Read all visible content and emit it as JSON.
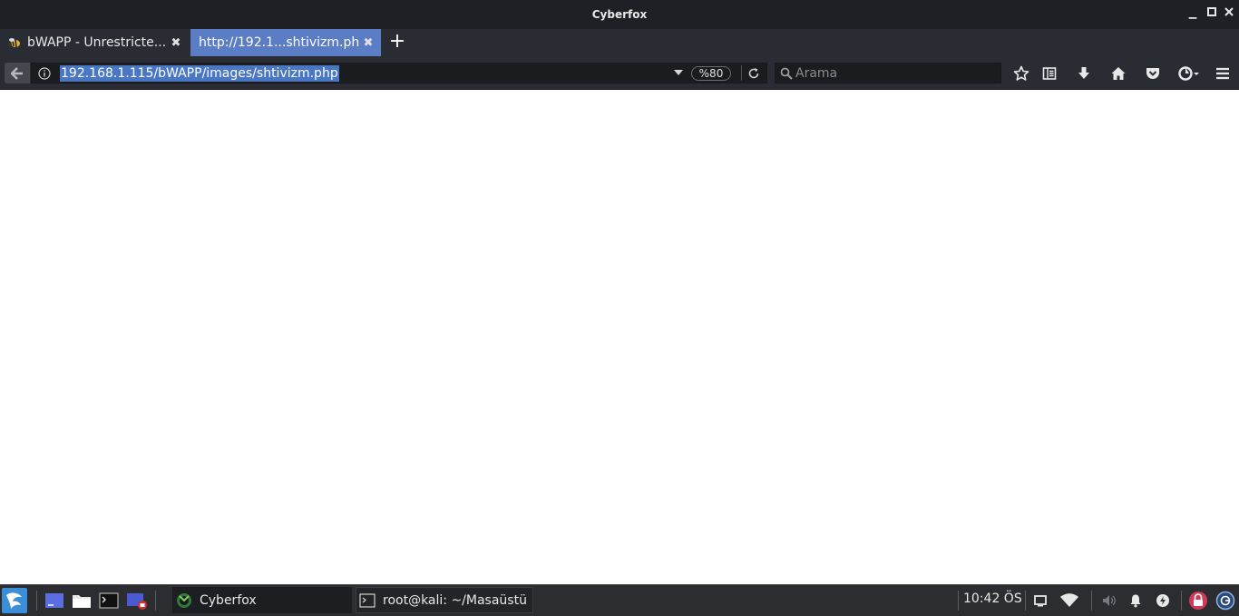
{
  "window": {
    "title": "Cyberfox"
  },
  "tabs": [
    {
      "label": "bWAPP - Unrestricte...",
      "active": false
    },
    {
      "label": "http://192.1...shtivizm.php",
      "active": true
    }
  ],
  "navbar": {
    "url": "192.168.1.115/bWAPP/images/shtivizm.php",
    "zoom": "%80",
    "search_placeholder": "Arama"
  },
  "taskbar": {
    "tasks": [
      {
        "label": "Cyberfox"
      },
      {
        "label": "root@kali: ~/Masaüstü"
      }
    ],
    "clock": "10:42 ÖS"
  },
  "colors": {
    "accent": "#5b7dc6",
    "url_selection": "#4a77c4",
    "chrome_dark": "#2a2c33",
    "titlebar": "#1e2026",
    "taskbar": "#2b2d31"
  },
  "icons": {
    "back": "back-arrow-icon",
    "info": "info-icon",
    "reload": "reload-icon",
    "search": "search-icon",
    "bookmark": "star-icon",
    "reader": "reading-list-icon",
    "download": "download-icon",
    "home": "home-icon",
    "pocket": "pocket-icon",
    "cyberfox": "cyberfox-menu-icon",
    "menu": "hamburger-menu-icon"
  }
}
